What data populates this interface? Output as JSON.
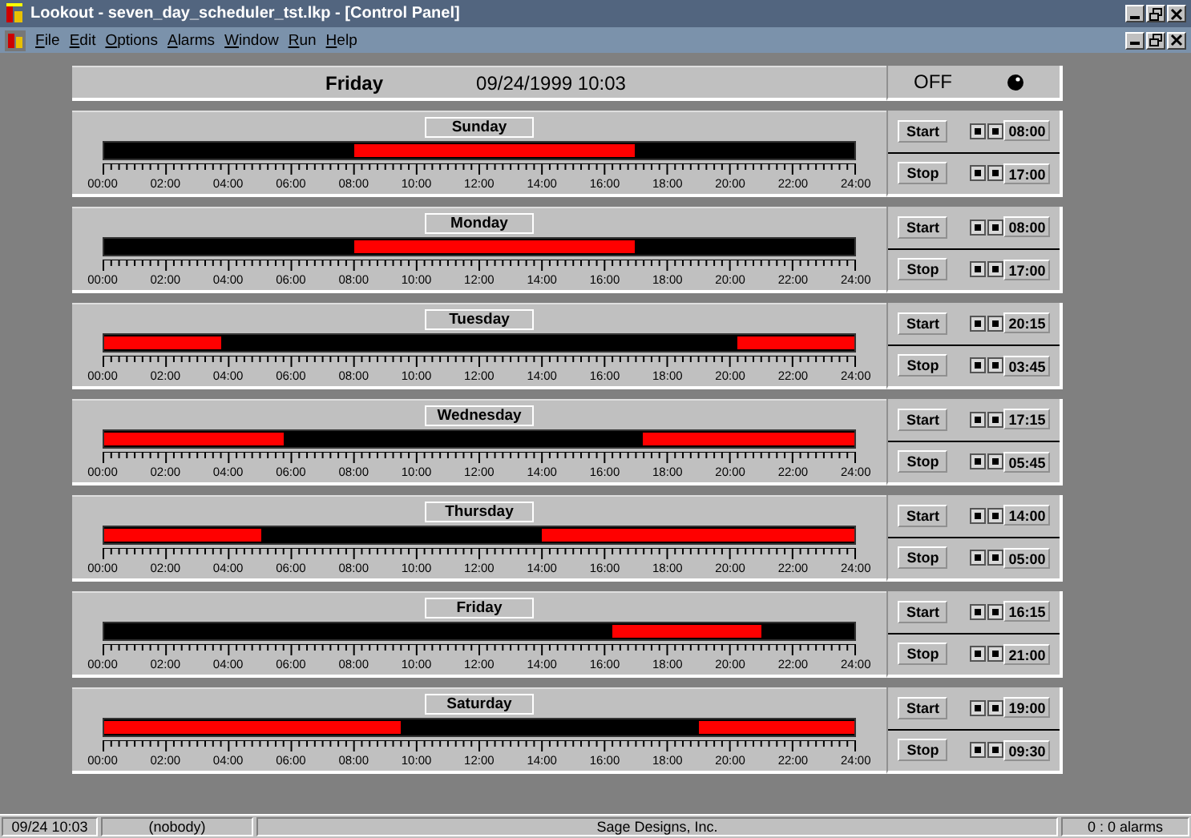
{
  "window": {
    "title": "Lookout - seven_day_scheduler_tst.lkp - [Control Panel]"
  },
  "menu": [
    "File",
    "Edit",
    "Options",
    "Alarms",
    "Window",
    "Run",
    "Help"
  ],
  "header": {
    "day": "Friday",
    "datetime": "09/24/1999 10:03",
    "status": "OFF"
  },
  "days": [
    {
      "name": "Sunday",
      "axis_labels": [
        "00:00",
        "02:00",
        "04:00",
        "06:00",
        "08:00",
        "10:00",
        "12:00",
        "14:00",
        "16:00",
        "18:00",
        "20:00",
        "22:00",
        "24:00"
      ],
      "start_label": "Start",
      "start_time": "08:00",
      "stop_label": "Stop",
      "stop_time": "17:00"
    },
    {
      "name": "Monday",
      "axis_labels": [
        "00:00",
        "02:00",
        "04:00",
        "06:00",
        "08:00",
        "10:00",
        "12:00",
        "14:00",
        "16:00",
        "18:00",
        "20:00",
        "22:00",
        "24:00"
      ],
      "start_label": "Start",
      "start_time": "08:00",
      "stop_label": "Stop",
      "stop_time": "17:00"
    },
    {
      "name": "Tuesday",
      "axis_labels": [
        "00:00",
        "02:00",
        "04:00",
        "06:00",
        "08:00",
        "10:00",
        "12:00",
        "14:00",
        "16:00",
        "18:00",
        "20:00",
        "22:00",
        "24:00"
      ],
      "start_label": "Start",
      "start_time": "20:15",
      "stop_label": "Stop",
      "stop_time": "03:45"
    },
    {
      "name": "Wednesday",
      "axis_labels": [
        "00:00",
        "02:00",
        "04:00",
        "06:00",
        "08:00",
        "10:00",
        "12:00",
        "14:00",
        "16:00",
        "18:00",
        "20:00",
        "22:00",
        "24:00"
      ],
      "start_label": "Start",
      "start_time": "17:15",
      "stop_label": "Stop",
      "stop_time": "05:45"
    },
    {
      "name": "Thursday",
      "axis_labels": [
        "00:00",
        "02:00",
        "04:00",
        "06:00",
        "08:00",
        "10:00",
        "12:00",
        "14:00",
        "16:00",
        "18:00",
        "20:00",
        "22:00",
        "24:00"
      ],
      "start_label": "Start",
      "start_time": "14:00",
      "stop_label": "Stop",
      "stop_time": "05:00"
    },
    {
      "name": "Friday",
      "axis_labels": [
        "00:00",
        "02:00",
        "04:00",
        "06:00",
        "08:00",
        "10:00",
        "12:00",
        "14:00",
        "16:00",
        "18:00",
        "20:00",
        "22:00",
        "24:00"
      ],
      "start_label": "Start",
      "start_time": "16:15",
      "stop_label": "Stop",
      "stop_time": "21:00"
    },
    {
      "name": "Saturday",
      "axis_labels": [
        "00:00",
        "02:00",
        "04:00",
        "06:00",
        "08:00",
        "10:00",
        "12:00",
        "14:00",
        "16:00",
        "18:00",
        "20:00",
        "22:00",
        "24:00"
      ],
      "start_label": "Start",
      "start_time": "19:00",
      "stop_label": "Stop",
      "stop_time": "09:30"
    }
  ],
  "status_bar": [
    "09/24 10:03",
    "(nobody)",
    "Sage Designs, Inc.",
    "0 : 0 alarms"
  ]
}
